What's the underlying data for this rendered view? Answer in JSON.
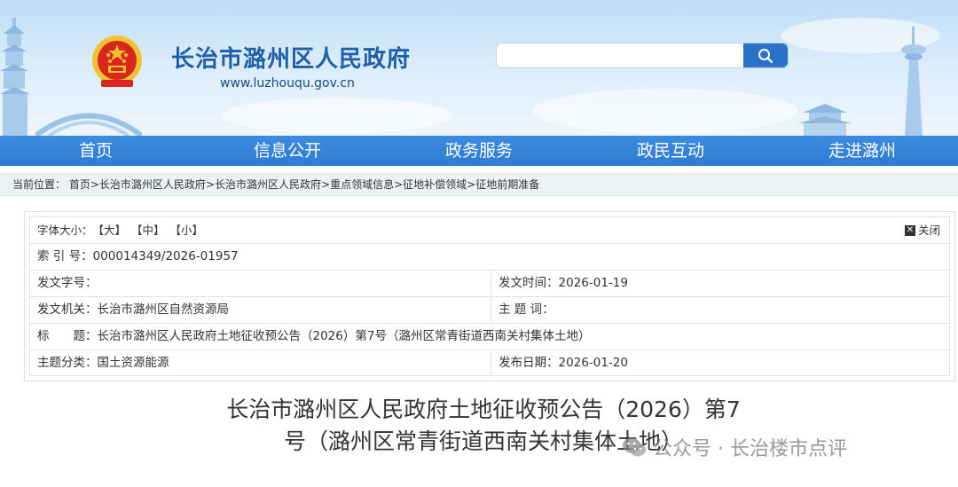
{
  "header": {
    "site_title": "长治市潞州区人民政府",
    "site_url": "www.luzhouqu.gov.cn",
    "search": {
      "placeholder": "",
      "icon": "search-icon"
    }
  },
  "nav": {
    "items": [
      {
        "label": "首页"
      },
      {
        "label": "信息公开"
      },
      {
        "label": "政务服务"
      },
      {
        "label": "政民互动"
      },
      {
        "label": "走进潞州"
      }
    ]
  },
  "breadcrumb": {
    "prefix": "当前位置：",
    "items": [
      "首页",
      "长治市潞州区人民政府",
      "长治市潞州区人民政府",
      "重点领域信息",
      "征地补偿领域",
      "征地前期准备"
    ],
    "separator": ">"
  },
  "info_panel": {
    "font_size_label": "字体大小：",
    "font_sizes": [
      "【大】",
      "【中】",
      "【小】"
    ],
    "close_label": "关闭",
    "index_label": "索 引 号：",
    "index_value": "000014349/2026-01957",
    "doc_number_label": "发文字号：",
    "doc_number_value": "",
    "issue_time_label": "发文时间：",
    "issue_time_value": "2026-01-19",
    "issuer_label": "发文机关：",
    "issuer_value": "长治市潞州区自然资源局",
    "keywords_label": "主 题 词：",
    "keywords_value": "",
    "title_label": "标　　题：",
    "title_value": "长治市潞州区人民政府土地征收预公告（2026）第7号（潞州区常青街道西南关村集体土地）",
    "category_label": "主题分类：",
    "category_value": "国土资源能源",
    "publish_date_label": "发布日期：",
    "publish_date_value": "2026-01-20"
  },
  "article": {
    "title_line1": "长治市潞州区人民政府土地征收预公告（2026）第7",
    "title_line2": "号（潞州区常青街道西南关村集体土地）"
  },
  "watermark": {
    "text": "公众号 · 长治楼市点评"
  },
  "colors": {
    "brand_blue": "#1d5fa8",
    "nav_blue": "#2f7bd3",
    "search_button": "#2a72c7",
    "emblem_red": "#d9261c",
    "emblem_gold": "#f2c230"
  }
}
